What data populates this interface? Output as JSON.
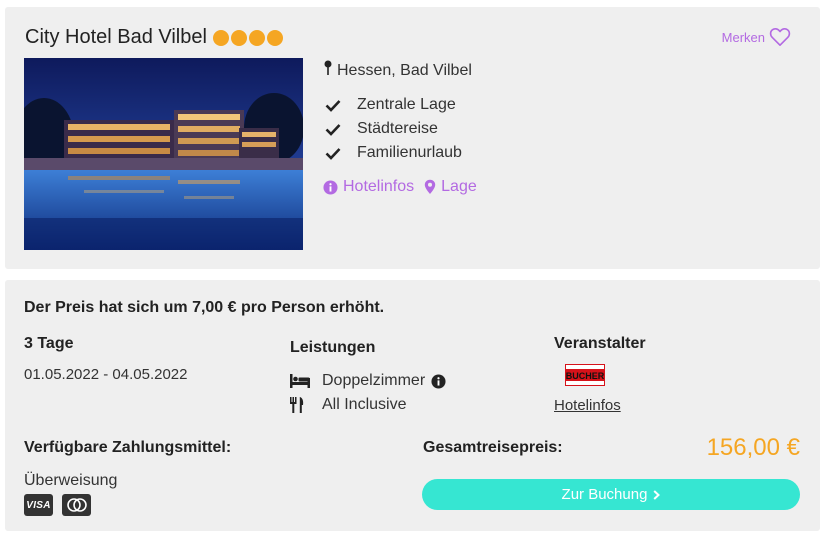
{
  "hotel": {
    "name": "City Hotel Bad Vilbel",
    "stars": 4,
    "location": "Hessen, Bad Vilbel",
    "features": [
      "Zentrale Lage",
      "Städtereise",
      "Familienurlaub"
    ],
    "links": {
      "hotelinfos": "Hotelinfos",
      "lage": "Lage"
    },
    "merken_label": "Merken"
  },
  "offer": {
    "price_change": "Der Preis hat sich um 7,00 € pro Person erhöht.",
    "duration": "3 Tage",
    "dates": "01.05.2022 - 04.05.2022",
    "leistungen_head": "Leistungen",
    "room": "Doppelzimmer",
    "board": "All Inclusive",
    "veranstalter_head": "Veranstalter",
    "veranstalter_logo_text": "BUCHER",
    "veranstalter_link": "Hotelinfos"
  },
  "payment": {
    "head": "Verfügbare Zahlungsmittel:",
    "method": "Überweisung",
    "cards": [
      "VISA",
      "mastercard"
    ]
  },
  "total": {
    "label": "Gesamtreisepreis:",
    "price": "156,00 €"
  },
  "booking": {
    "label": "Zur Buchung"
  },
  "colors": {
    "accent_purple": "#b36ae2",
    "star_orange": "#f5a623",
    "price_orange": "#f5a623",
    "button_teal": "#36e6d2",
    "card_bg": "#efefef"
  },
  "icons": [
    "star-dot",
    "heart-icon",
    "pin-icon",
    "check-icon",
    "info-icon",
    "location-pin-icon",
    "bed-icon",
    "cutlery-icon",
    "chevron-right-icon"
  ]
}
